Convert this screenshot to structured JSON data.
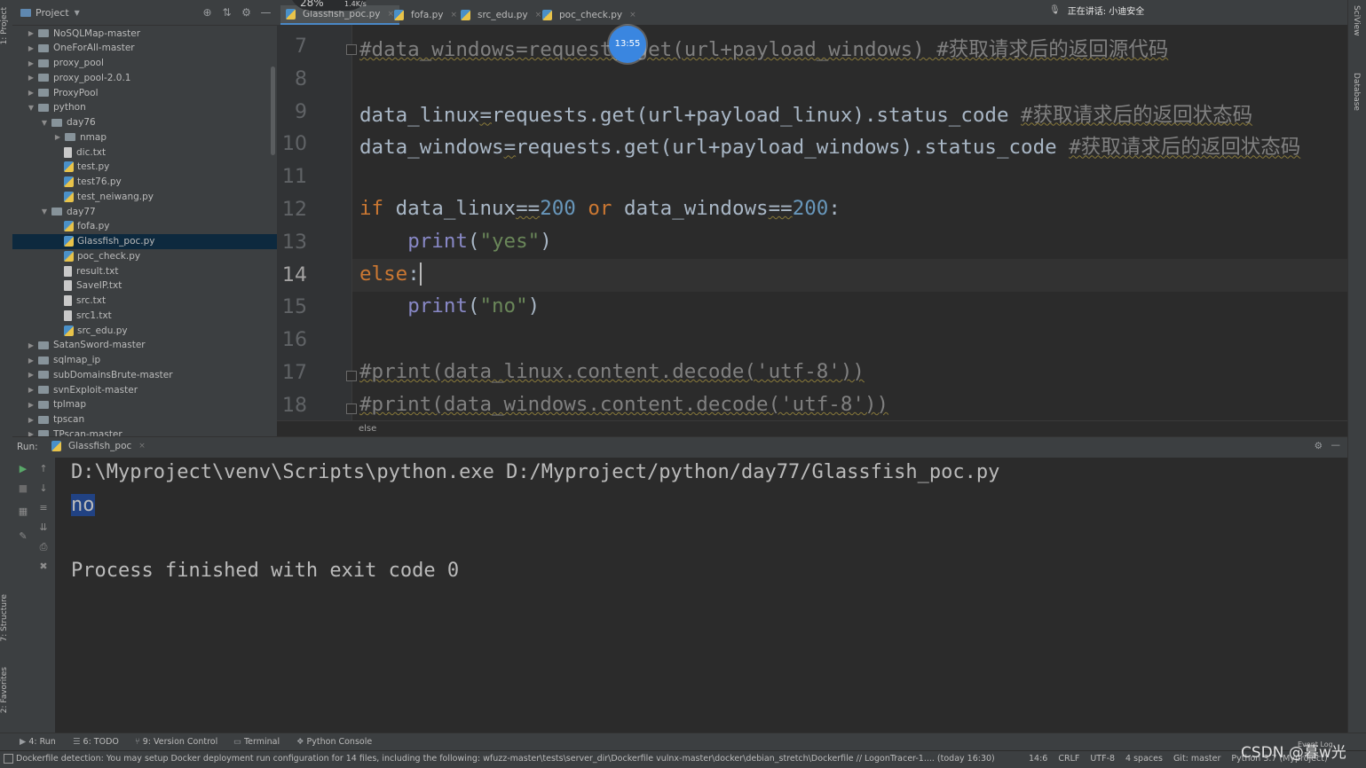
{
  "project": {
    "title": "Project",
    "tree": [
      {
        "label": "NoSQLMap-master",
        "kind": "folder",
        "depth": 0,
        "expanded": false
      },
      {
        "label": "OneForAll-master",
        "kind": "folder",
        "depth": 0,
        "expanded": false
      },
      {
        "label": "proxy_pool",
        "kind": "folder",
        "depth": 0,
        "expanded": false
      },
      {
        "label": "proxy_pool-2.0.1",
        "kind": "folder",
        "depth": 0,
        "expanded": false
      },
      {
        "label": "ProxyPool",
        "kind": "folder",
        "depth": 0,
        "expanded": false
      },
      {
        "label": "python",
        "kind": "folder",
        "depth": 0,
        "expanded": true
      },
      {
        "label": "day76",
        "kind": "folder",
        "depth": 1,
        "expanded": true
      },
      {
        "label": "nmap",
        "kind": "folder",
        "depth": 2,
        "expanded": false
      },
      {
        "label": "dic.txt",
        "kind": "txt",
        "depth": 2
      },
      {
        "label": "test.py",
        "kind": "py",
        "depth": 2
      },
      {
        "label": "test76.py",
        "kind": "py",
        "depth": 2
      },
      {
        "label": "test_neiwang.py",
        "kind": "py",
        "depth": 2
      },
      {
        "label": "day77",
        "kind": "folder",
        "depth": 1,
        "expanded": true
      },
      {
        "label": "fofa.py",
        "kind": "py",
        "depth": 2
      },
      {
        "label": "Glassfish_poc.py",
        "kind": "py",
        "depth": 2,
        "selected": true
      },
      {
        "label": "poc_check.py",
        "kind": "py",
        "depth": 2
      },
      {
        "label": "result.txt",
        "kind": "txt",
        "depth": 2
      },
      {
        "label": "SaveIP.txt",
        "kind": "txt",
        "depth": 2
      },
      {
        "label": "src.txt",
        "kind": "txt",
        "depth": 2
      },
      {
        "label": "src1.txt",
        "kind": "txt",
        "depth": 2
      },
      {
        "label": "src_edu.py",
        "kind": "py",
        "depth": 2
      },
      {
        "label": "SatanSword-master",
        "kind": "folder",
        "depth": 0,
        "expanded": false
      },
      {
        "label": "sqlmap_ip",
        "kind": "folder",
        "depth": 0,
        "expanded": false
      },
      {
        "label": "subDomainsBrute-master",
        "kind": "folder",
        "depth": 0,
        "expanded": false
      },
      {
        "label": "svnExploit-master",
        "kind": "folder",
        "depth": 0,
        "expanded": false
      },
      {
        "label": "tplmap",
        "kind": "folder",
        "depth": 0,
        "expanded": false
      },
      {
        "label": "tpscan",
        "kind": "folder",
        "depth": 0,
        "expanded": false
      },
      {
        "label": "TPscan-master",
        "kind": "folder",
        "depth": 0,
        "expanded": false
      }
    ]
  },
  "left_stripe": {
    "project_tab": "1: Project",
    "structure_tab": "7: Structure",
    "favorites_tab": "2: Favorites"
  },
  "right_stripe": {
    "sciview_tab": "SciView",
    "database_tab": "Database"
  },
  "tabs": [
    {
      "label": "Glassfish_poc.py",
      "active": true
    },
    {
      "label": "fofa.py",
      "active": false
    },
    {
      "label": "src_edu.py",
      "active": false
    },
    {
      "label": "poc_check.py",
      "active": false
    }
  ],
  "overlay": {
    "speaking": "正在讲话: 小迪安全",
    "timer": "13:55",
    "perf_percent": "28%",
    "perf_speed": "1.4K/s"
  },
  "editor": {
    "current_line": 14,
    "lines": [
      {
        "n": "7",
        "parts": [
          {
            "t": "#data_windows=requests.get(url+payload_windows) #获取请求后的返回源代码",
            "c": "cm squig"
          }
        ]
      },
      {
        "n": "8",
        "parts": []
      },
      {
        "n": "9",
        "parts": [
          {
            "t": "data_linux",
            "c": ""
          },
          {
            "t": "=",
            "c": "squig"
          },
          {
            "t": "requests.get(url+payload_linux).status_code ",
            "c": ""
          },
          {
            "t": "#获取请求后的返回状态码",
            "c": "cm squig"
          }
        ]
      },
      {
        "n": "10",
        "parts": [
          {
            "t": "data_windows",
            "c": ""
          },
          {
            "t": "=",
            "c": "squig"
          },
          {
            "t": "requests.get(url+payload_windows).status_code ",
            "c": ""
          },
          {
            "t": "#获取请求后的返回状态码",
            "c": "cm squig"
          }
        ]
      },
      {
        "n": "11",
        "parts": []
      },
      {
        "n": "12",
        "parts": [
          {
            "t": "if ",
            "c": "kw"
          },
          {
            "t": "data_linux",
            "c": ""
          },
          {
            "t": "==",
            "c": "squig"
          },
          {
            "t": "200",
            "c": "num"
          },
          {
            "t": " or ",
            "c": "kw"
          },
          {
            "t": "data_windows",
            "c": ""
          },
          {
            "t": "==",
            "c": "squig"
          },
          {
            "t": "200",
            "c": "num"
          },
          {
            "t": ":",
            "c": ""
          }
        ]
      },
      {
        "n": "13",
        "parts": [
          {
            "t": "    ",
            "c": ""
          },
          {
            "t": "print",
            "c": "fn"
          },
          {
            "t": "(",
            "c": ""
          },
          {
            "t": "\"yes\"",
            "c": "str"
          },
          {
            "t": ")",
            "c": ""
          }
        ]
      },
      {
        "n": "14",
        "parts": [
          {
            "t": "else",
            "c": "kw"
          },
          {
            "t": ":",
            "c": ""
          }
        ]
      },
      {
        "n": "15",
        "parts": [
          {
            "t": "    ",
            "c": ""
          },
          {
            "t": "print",
            "c": "fn"
          },
          {
            "t": "(",
            "c": ""
          },
          {
            "t": "\"no\"",
            "c": "str"
          },
          {
            "t": ")",
            "c": ""
          }
        ]
      },
      {
        "n": "16",
        "parts": []
      },
      {
        "n": "17",
        "parts": [
          {
            "t": "#print(data_linux.content.decode('utf-8'))",
            "c": "cm squig"
          }
        ]
      },
      {
        "n": "18",
        "parts": [
          {
            "t": "#print(data_windows.content.decode('utf-8'))",
            "c": "cm squig"
          }
        ]
      }
    ],
    "breadcrumb": "else"
  },
  "run": {
    "label": "Run:",
    "tab": "Glassfish_poc",
    "console": [
      {
        "text": "D:\\Myproject\\venv\\Scripts\\python.exe D:/Myproject/python/day77/Glassfish_poc.py",
        "selected": false
      },
      {
        "text": "no",
        "selected": true
      },
      {
        "text": "",
        "selected": false
      },
      {
        "text": "Process finished with exit code 0",
        "selected": false
      }
    ]
  },
  "tool_tabs": [
    "4: Run",
    "6: TODO",
    "9: Version Control",
    "Terminal",
    "Python Console"
  ],
  "status": {
    "message": "Dockerfile detection: You may setup Docker deployment run configuration for 14 files, including the following: wfuzz-master\\tests\\server_dir\\Dockerfile vulnx-master\\docker\\debian_stretch\\Dockerfile // LogonTracer-1.... (today 16:30)",
    "position": "14:6",
    "line_sep": "CRLF",
    "encoding": "UTF-8",
    "indent": "4 spaces",
    "git": "Git: master",
    "interpreter": "Python 3.7 (Myproject)",
    "event_log": "Event Log"
  },
  "watermark": "CSDN @暮w光"
}
